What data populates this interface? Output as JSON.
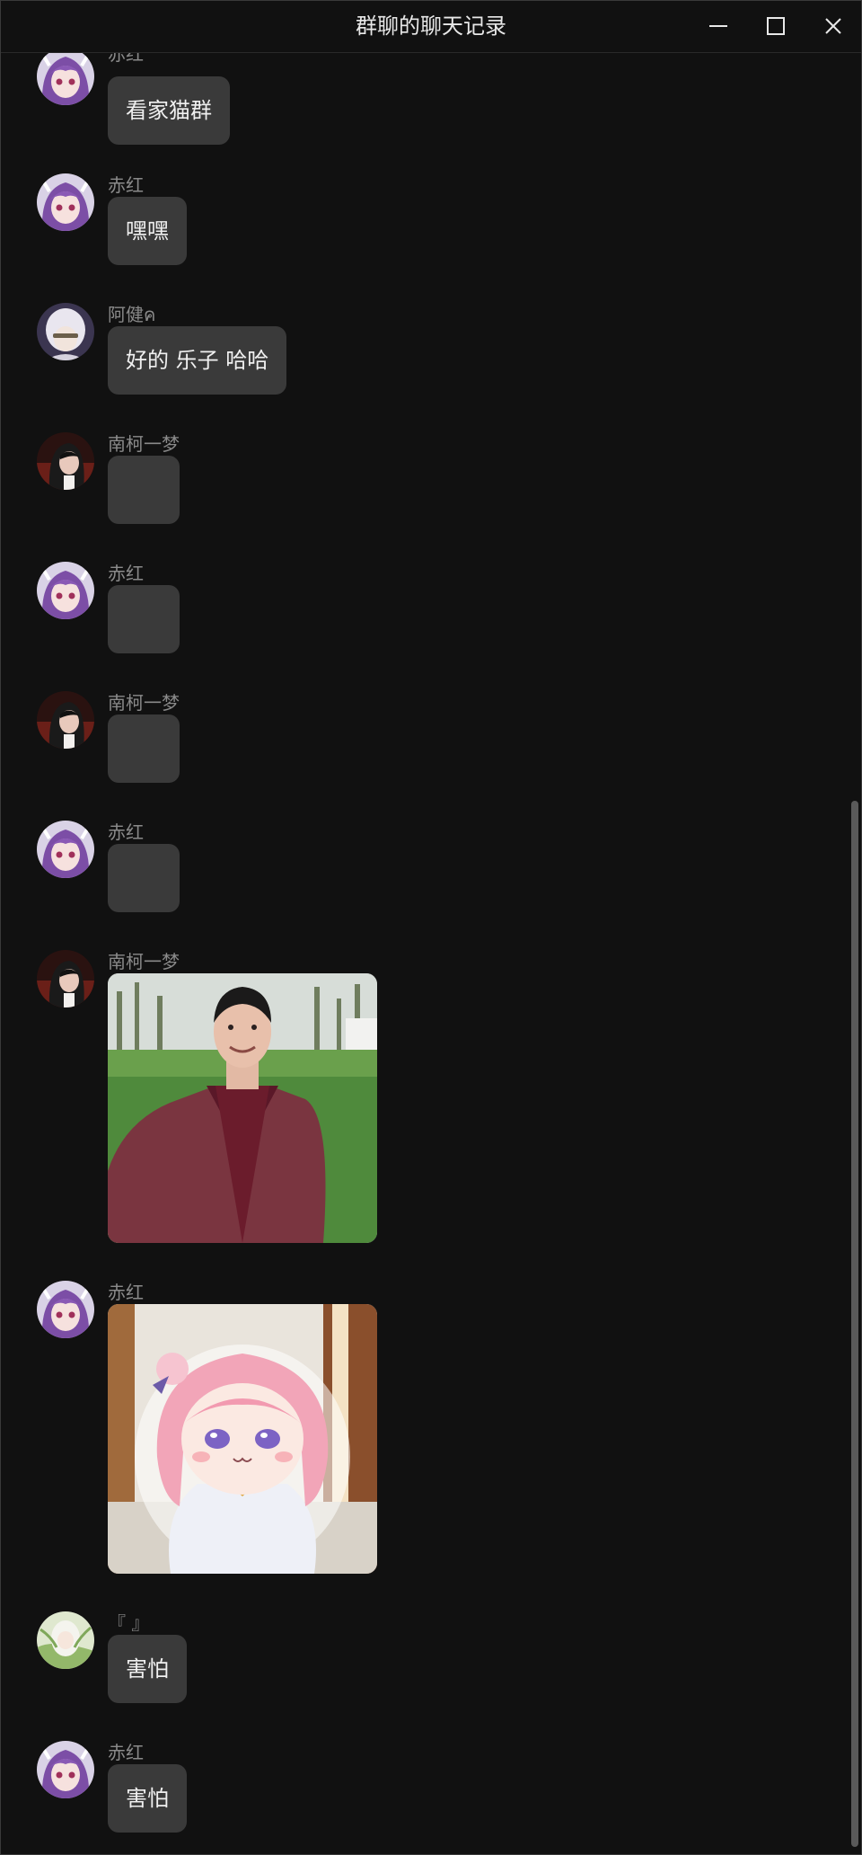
{
  "window": {
    "title": "群聊的聊天记录"
  },
  "messages": [
    {
      "sender": "赤红",
      "text": "看家猫群"
    },
    {
      "sender": "赤红",
      "text": "嘿嘿"
    },
    {
      "sender": "阿健ค",
      "text": "好的  乐子  哈哈"
    },
    {
      "sender": "南柯一梦",
      "text": ""
    },
    {
      "sender": "赤红",
      "text": ""
    },
    {
      "sender": "南柯一梦",
      "text": ""
    },
    {
      "sender": "赤红",
      "text": ""
    },
    {
      "sender": "南柯一梦",
      "image": "photo-man-in-field"
    },
    {
      "sender": "赤红",
      "image": "anime-girl-sticker"
    },
    {
      "sender": "『 』",
      "text": "害怕"
    },
    {
      "sender": "赤红",
      "text": "害怕"
    }
  ],
  "colors": {
    "background": "#111111",
    "bubble": "#3a3a3a",
    "sender_text": "#8a8a8a",
    "message_text": "#f0f0f0"
  }
}
